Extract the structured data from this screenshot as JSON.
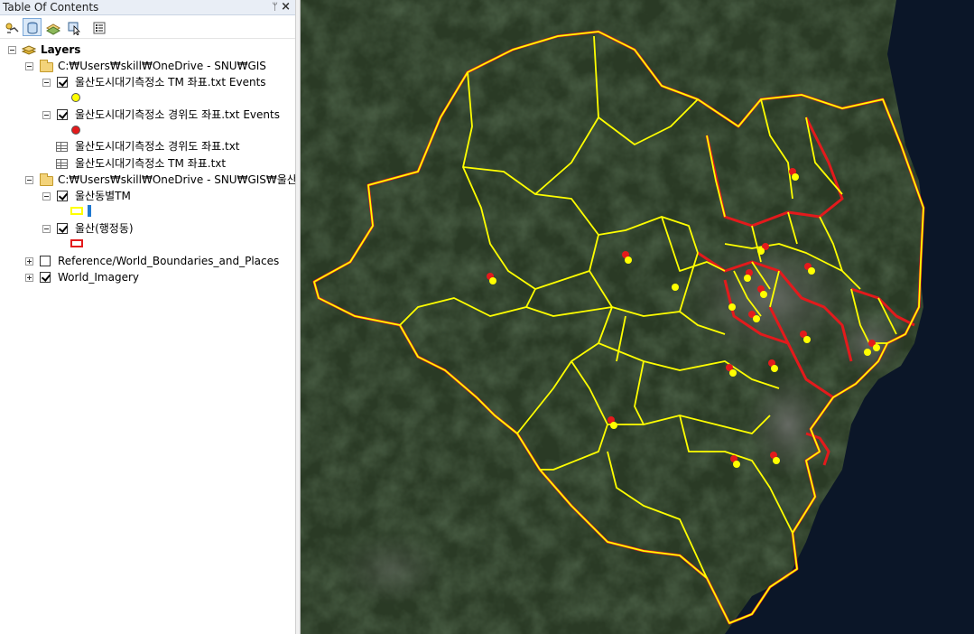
{
  "toc": {
    "title": "Table Of Contents",
    "pin_glyph": "ᛘ",
    "close_glyph": "×",
    "toolbar": [
      {
        "name": "list-by-drawing-order-button",
        "icon": "layers-icon"
      },
      {
        "name": "list-by-source-button",
        "icon": "database-icon"
      },
      {
        "name": "list-by-visibility-button",
        "icon": "visibility-icon"
      },
      {
        "name": "list-by-selection-button",
        "icon": "selection-icon"
      },
      {
        "name": "options-button",
        "icon": "options-icon"
      }
    ],
    "tree": {
      "root_label": "Layers",
      "group1_path": "C:₩Users₩skill₩OneDrive - SNU₩GIS",
      "layer_tm_events": "울산도시대기측정소 TM 좌표.txt Events",
      "layer_wgs_events": "울산도시대기측정소 경위도 좌표.txt Events",
      "table_wgs": "울산도시대기측정소 경위도 좌표.txt",
      "table_tm": "울산도시대기측정소 TM 좌표.txt",
      "group2_path": "C:₩Users₩skill₩OneDrive - SNU₩GIS₩울산 shp",
      "layer_dong_tm": "울산동별TM",
      "layer_haengjeong": "울산(행정동)",
      "layer_reference": "Reference/World_Boundaries_and_Places",
      "layer_imagery": "World_Imagery"
    },
    "checked": {
      "tm_events": true,
      "wgs_events": true,
      "dong_tm": true,
      "haengjeong": true,
      "reference": false,
      "imagery": true
    }
  },
  "colors": {
    "tm_events_symbol": "#ffff00",
    "wgs_events_symbol": "#e31a1c",
    "dong_tm_outline": "#ffff00",
    "dong_tm_bar": "#1f78d0",
    "haengjeong_outline": "#e31a1c",
    "imagery_land": "#263722",
    "imagery_sea": "#0b1628"
  }
}
